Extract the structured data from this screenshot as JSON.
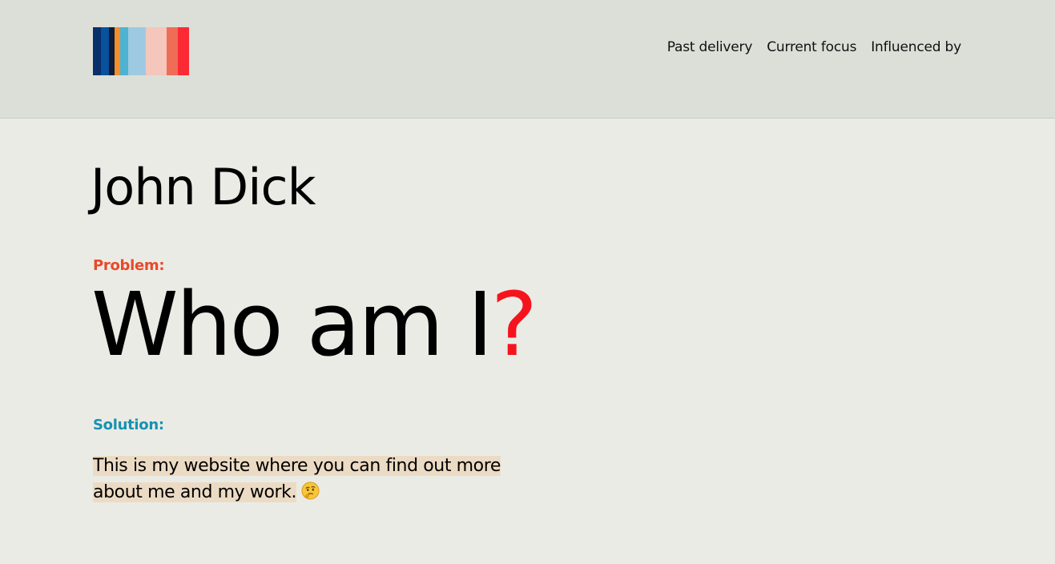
{
  "header": {
    "logo_stripes": [
      "#08306b",
      "#08519c",
      "#0b1d3a",
      "#f28e2b",
      "#4eb3d3",
      "#9ecae1",
      "#9ecae1",
      "#f5c6bb",
      "#f5c6bb",
      "#ef6c57",
      "#fb2a35"
    ],
    "nav": {
      "past_delivery": "Past delivery",
      "current_focus": "Current focus",
      "influenced_by": "Influenced by"
    }
  },
  "main": {
    "name": "John Dick",
    "problem_label": "Problem:",
    "question_text": "Who am I",
    "question_mark": "?",
    "solution_label": "Solution:",
    "description": "This is my website where you can find out more about me and my work.",
    "description_icon": "thinking-face-icon"
  },
  "colors": {
    "header_bg": "#dcdfd8",
    "page_bg": "#ebebe5",
    "problem_label": "#e8492a",
    "solution_label": "#1592b2",
    "question_mark": "#f5141e",
    "highlight": "#ecdbc4"
  }
}
